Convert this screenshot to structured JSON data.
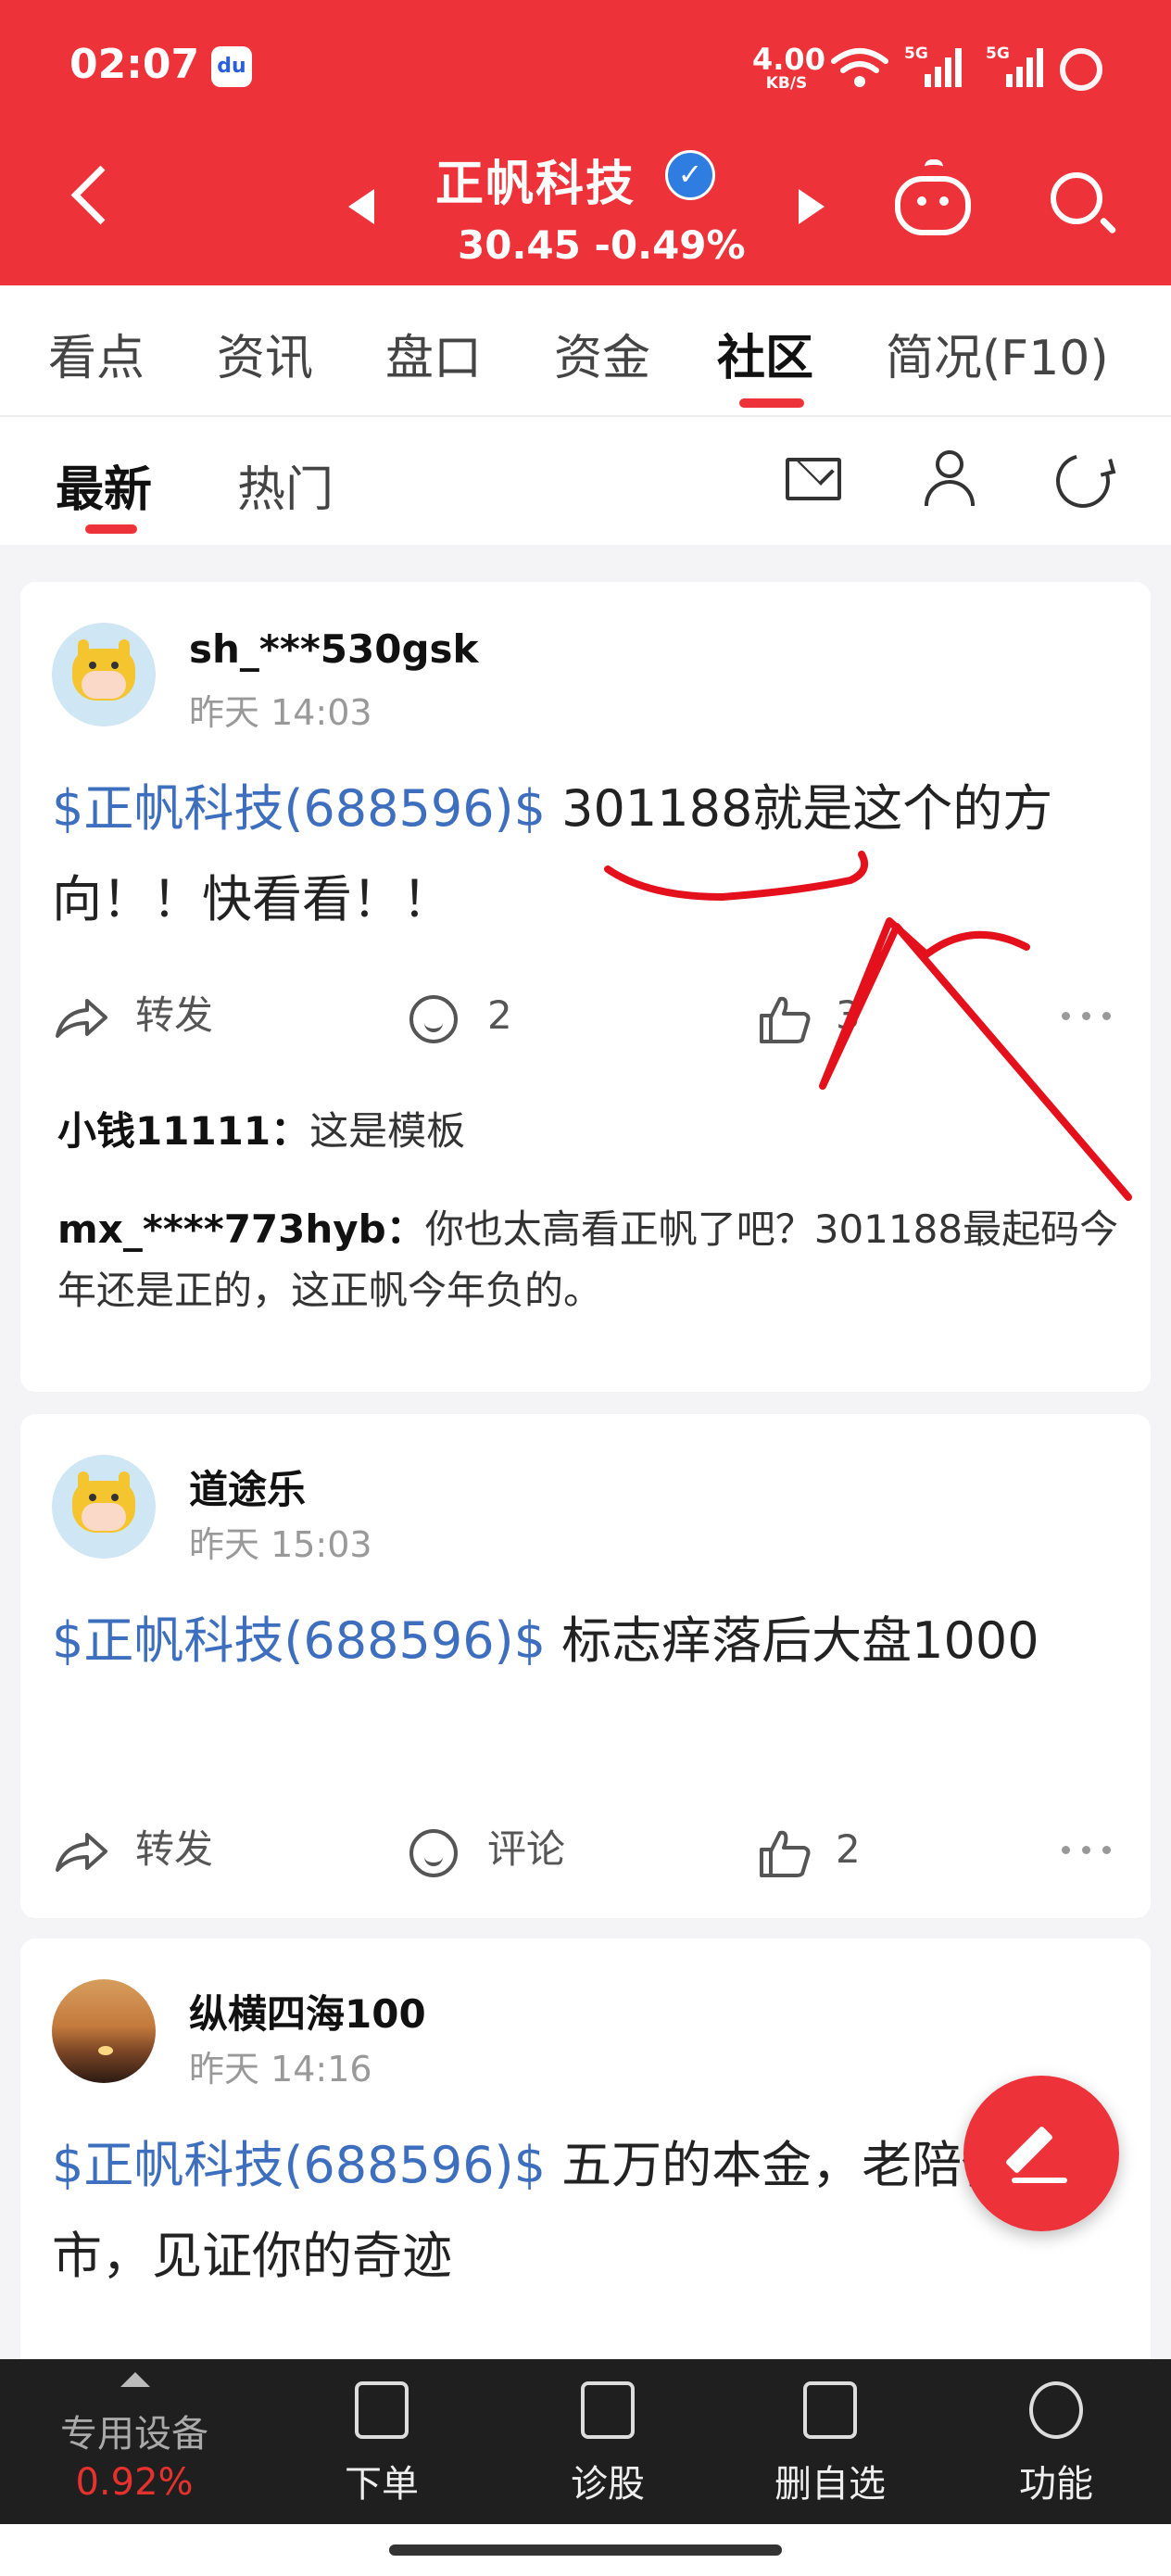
{
  "status_bar": {
    "time": "02:07",
    "app_icon": "du",
    "net_speed_value": "4.00",
    "net_speed_unit": "KB/S",
    "signal1_label": "5G",
    "signal2_label": "5G"
  },
  "header": {
    "stock_name": "正帆科技",
    "price_change": "30.45 -0.49%"
  },
  "tabs": [
    {
      "label": "看点"
    },
    {
      "label": "资讯"
    },
    {
      "label": "盘口"
    },
    {
      "label": "资金"
    },
    {
      "label": "社区",
      "active": true
    },
    {
      "label": "简况(F10)"
    }
  ],
  "subtabs": [
    {
      "label": "最新",
      "active": true
    },
    {
      "label": "热门"
    }
  ],
  "posts": [
    {
      "username": "sh_***530gsk",
      "time": "昨天 14:03",
      "tag": "$正帆科技(688596)$",
      "text": " 301188就是这个的方向！！快看看！！",
      "share_label": "转发",
      "comment_label": "2",
      "like_label": "3",
      "replies": [
        {
          "user": "小钱11111：",
          "text": "这是模板"
        },
        {
          "user": "mx_****773hyb：",
          "text": "你也太高看正帆了吧？301188最起码今年还是正的，这正帆今年负的。"
        }
      ]
    },
    {
      "username": "道途乐",
      "time": "昨天 15:03",
      "tag": "$正帆科技(688596)$",
      "text": " 标志痒落后大盘1000",
      "share_label": "转发",
      "comment_label": "评论",
      "like_label": "2"
    },
    {
      "username": "纵横四海100",
      "time": "昨天 14:16",
      "tag": "$正帆科技(688596)$",
      "text": " 五万的本金，老陪你到退市，见证你的奇迹"
    }
  ],
  "bottom_bar": {
    "device_label": "专用设备",
    "device_change": "0.92%",
    "items": [
      {
        "label": "下单"
      },
      {
        "label": "诊股"
      },
      {
        "label": "删自选"
      },
      {
        "label": "功能"
      }
    ]
  },
  "colors": {
    "brand_red": "#ed3239",
    "link_blue": "#3e6fbf",
    "annotation_red": "#e4101c"
  }
}
